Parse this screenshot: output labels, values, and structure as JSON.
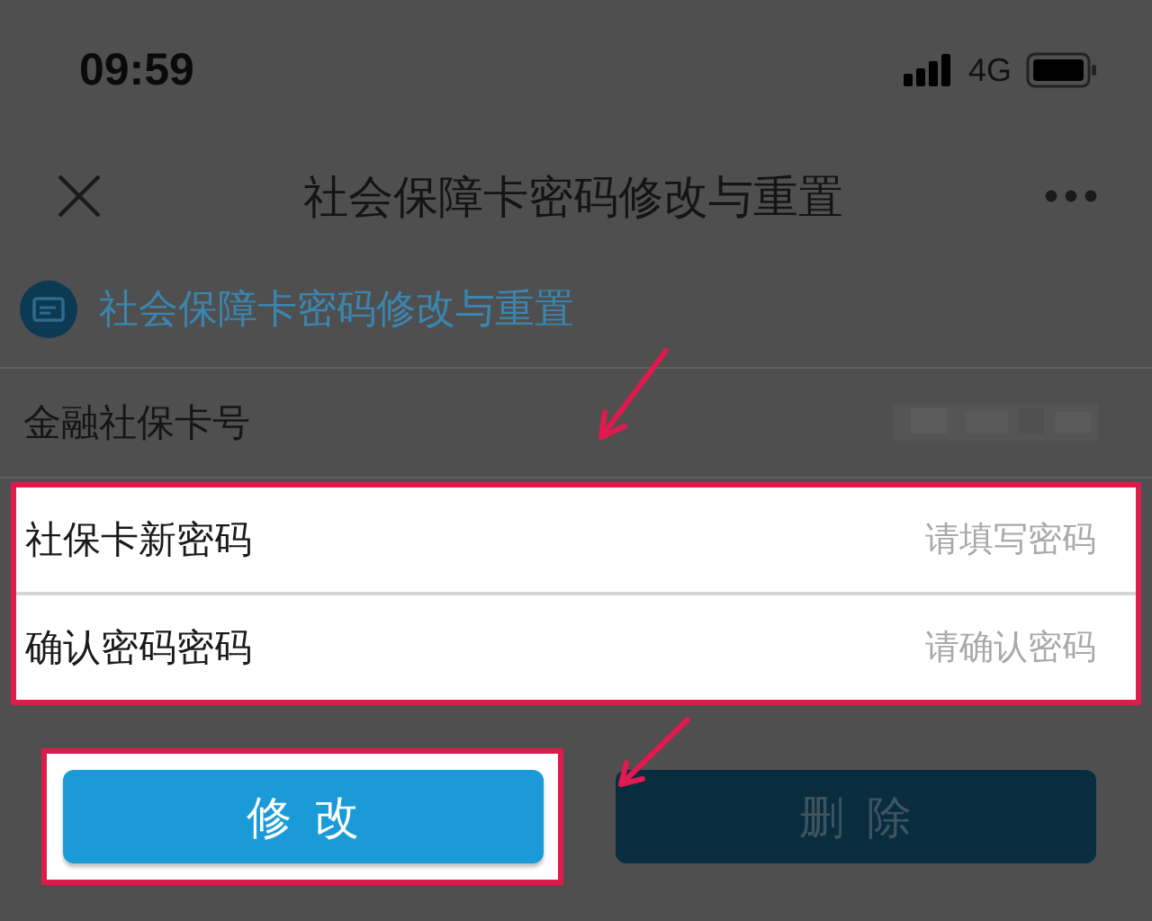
{
  "status_bar": {
    "time": "09:59",
    "network": "4G"
  },
  "nav": {
    "title": "社会保障卡密码修改与重置"
  },
  "section": {
    "title": "社会保障卡密码修改与重置"
  },
  "card_number": {
    "label": "金融社保卡号"
  },
  "password_form": {
    "highlighted": true,
    "fields": [
      {
        "label": "社保卡新密码",
        "placeholder": "请填写密码"
      },
      {
        "label": "确认密码密码",
        "placeholder": "请确认密码"
      }
    ]
  },
  "buttons": [
    {
      "label": "修改",
      "kind": "primary",
      "highlighted": true
    },
    {
      "label": "删除",
      "kind": "disabled"
    }
  ]
}
